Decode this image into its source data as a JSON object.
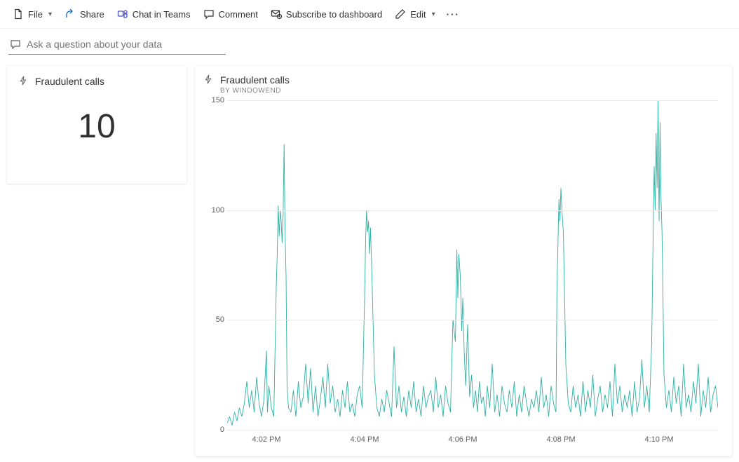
{
  "toolbar": {
    "file": "File",
    "share": "Share",
    "chat": "Chat in Teams",
    "comment": "Comment",
    "subscribe": "Subscribe to dashboard",
    "edit": "Edit"
  },
  "qa": {
    "placeholder": "Ask a question about your data"
  },
  "kpi": {
    "title": "Fraudulent calls",
    "value": "10"
  },
  "chart": {
    "title": "Fraudulent calls",
    "subtitle": "BY WINDOWEND",
    "colors": {
      "series": "#2fb1a3"
    }
  },
  "chart_data": {
    "type": "line",
    "title": "Fraudulent calls",
    "xlabel": "",
    "ylabel": "",
    "ylim": [
      0,
      150
    ],
    "x_ticks": [
      "4:02 PM",
      "4:04 PM",
      "4:06 PM",
      "4:08 PM",
      "4:10 PM"
    ],
    "x_tick_positions": [
      0.08,
      0.28,
      0.48,
      0.68,
      0.88
    ],
    "y_ticks": [
      0,
      50,
      100,
      150
    ],
    "series": [
      {
        "name": "Fraudulent calls",
        "color": "#2fb1a3",
        "x": [
          0.0,
          0.005,
          0.01,
          0.015,
          0.02,
          0.025,
          0.03,
          0.035,
          0.04,
          0.045,
          0.05,
          0.055,
          0.06,
          0.065,
          0.07,
          0.075,
          0.08,
          0.082,
          0.085,
          0.09,
          0.095,
          0.1,
          0.102,
          0.104,
          0.106,
          0.108,
          0.11,
          0.112,
          0.114,
          0.116,
          0.118,
          0.12,
          0.122,
          0.125,
          0.13,
          0.135,
          0.14,
          0.145,
          0.15,
          0.155,
          0.16,
          0.165,
          0.17,
          0.175,
          0.18,
          0.185,
          0.19,
          0.195,
          0.2,
          0.205,
          0.21,
          0.215,
          0.22,
          0.225,
          0.23,
          0.235,
          0.24,
          0.245,
          0.25,
          0.255,
          0.26,
          0.265,
          0.27,
          0.275,
          0.28,
          0.282,
          0.284,
          0.286,
          0.288,
          0.29,
          0.292,
          0.295,
          0.3,
          0.305,
          0.31,
          0.315,
          0.32,
          0.325,
          0.33,
          0.335,
          0.34,
          0.345,
          0.35,
          0.355,
          0.36,
          0.365,
          0.37,
          0.375,
          0.38,
          0.385,
          0.39,
          0.395,
          0.4,
          0.405,
          0.41,
          0.415,
          0.42,
          0.425,
          0.43,
          0.435,
          0.44,
          0.445,
          0.45,
          0.455,
          0.46,
          0.465,
          0.468,
          0.47,
          0.472,
          0.475,
          0.478,
          0.48,
          0.483,
          0.486,
          0.49,
          0.494,
          0.498,
          0.502,
          0.506,
          0.51,
          0.514,
          0.518,
          0.522,
          0.526,
          0.53,
          0.535,
          0.54,
          0.545,
          0.55,
          0.555,
          0.56,
          0.565,
          0.57,
          0.575,
          0.58,
          0.585,
          0.59,
          0.595,
          0.6,
          0.605,
          0.61,
          0.615,
          0.62,
          0.625,
          0.63,
          0.635,
          0.64,
          0.645,
          0.65,
          0.655,
          0.66,
          0.665,
          0.67,
          0.672,
          0.674,
          0.676,
          0.678,
          0.68,
          0.682,
          0.685,
          0.69,
          0.695,
          0.7,
          0.705,
          0.71,
          0.715,
          0.72,
          0.725,
          0.73,
          0.735,
          0.74,
          0.745,
          0.75,
          0.755,
          0.76,
          0.765,
          0.77,
          0.775,
          0.78,
          0.785,
          0.79,
          0.795,
          0.8,
          0.805,
          0.81,
          0.815,
          0.82,
          0.825,
          0.83,
          0.835,
          0.84,
          0.845,
          0.85,
          0.855,
          0.86,
          0.865,
          0.868,
          0.87,
          0.872,
          0.874,
          0.876,
          0.878,
          0.88,
          0.882,
          0.884,
          0.886,
          0.888,
          0.89,
          0.895,
          0.9,
          0.905,
          0.91,
          0.915,
          0.92,
          0.925,
          0.93,
          0.935,
          0.94,
          0.945,
          0.95,
          0.955,
          0.96,
          0.965,
          0.97,
          0.975,
          0.98,
          0.985,
          0.99,
          0.995,
          1.0
        ],
        "values": [
          3,
          6,
          2,
          8,
          4,
          10,
          6,
          12,
          22,
          10,
          18,
          8,
          24,
          12,
          6,
          14,
          36,
          8,
          20,
          10,
          6,
          65,
          80,
          102,
          88,
          100,
          95,
          85,
          98,
          130,
          90,
          70,
          20,
          10,
          8,
          18,
          6,
          22,
          10,
          15,
          30,
          12,
          28,
          8,
          20,
          6,
          14,
          24,
          10,
          30,
          12,
          20,
          8,
          14,
          6,
          18,
          10,
          22,
          8,
          12,
          6,
          16,
          20,
          10,
          60,
          85,
          100,
          90,
          95,
          80,
          92,
          70,
          25,
          10,
          6,
          14,
          8,
          18,
          12,
          6,
          38,
          10,
          20,
          8,
          15,
          6,
          18,
          10,
          22,
          8,
          14,
          6,
          20,
          10,
          15,
          18,
          8,
          24,
          10,
          16,
          6,
          20,
          12,
          8,
          50,
          40,
          82,
          60,
          80,
          70,
          45,
          60,
          35,
          20,
          48,
          15,
          25,
          10,
          18,
          8,
          22,
          12,
          15,
          6,
          20,
          10,
          30,
          8,
          16,
          6,
          20,
          12,
          8,
          18,
          10,
          22,
          6,
          16,
          8,
          20,
          12,
          6,
          14,
          10,
          18,
          8,
          24,
          10,
          16,
          6,
          20,
          12,
          8,
          65,
          85,
          105,
          95,
          110,
          100,
          90,
          30,
          12,
          8,
          20,
          10,
          16,
          6,
          22,
          8,
          18,
          10,
          25,
          6,
          14,
          20,
          8,
          16,
          10,
          22,
          6,
          30,
          12,
          20,
          8,
          16,
          10,
          18,
          6,
          22,
          8,
          14,
          32,
          10,
          20,
          8,
          40,
          90,
          120,
          100,
          135,
          110,
          150,
          95,
          140,
          105,
          90,
          60,
          25,
          10,
          18,
          8,
          24,
          12,
          20,
          6,
          30,
          10,
          16,
          8,
          22,
          12,
          30,
          6,
          18,
          10,
          24,
          8,
          16,
          20,
          10
        ]
      }
    ]
  }
}
